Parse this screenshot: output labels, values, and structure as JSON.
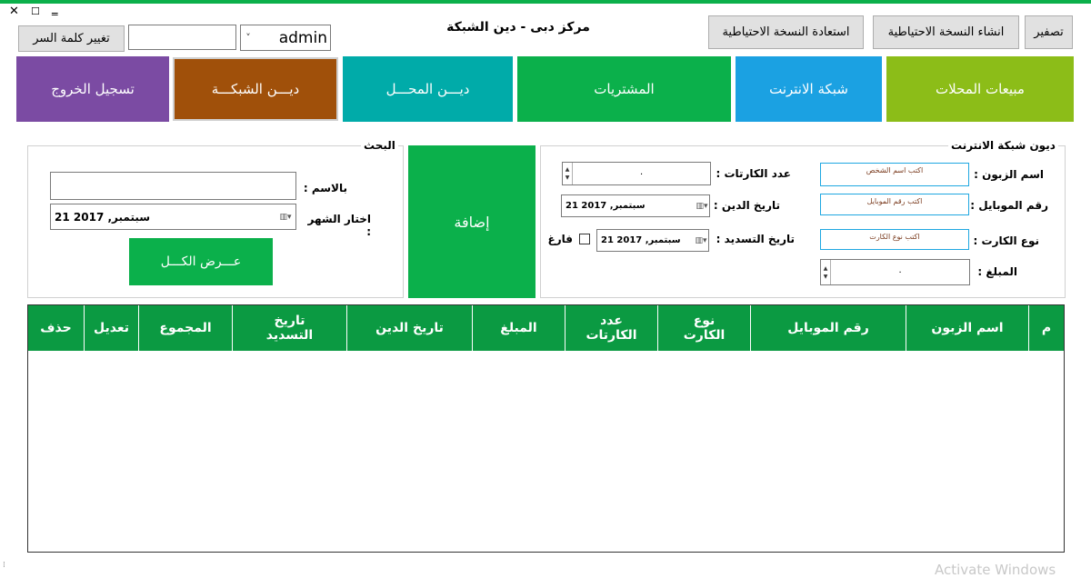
{
  "window": {
    "close_glyph": "✕",
    "maximize_glyph": "☐",
    "minimize_glyph": "‗"
  },
  "header": {
    "title": "مركز دبى - دين الشبكة",
    "change_password_label": "تغيير كلمة السر",
    "password_value": "",
    "user_selected": "admin",
    "user_dropdown_glyph": "˅",
    "clear_label": "تصفير",
    "create_backup_label": "انشاء النسخة الاحتياطية",
    "restore_backup_label": "استعادة النسخة الاحتياطية"
  },
  "nav": {
    "items": [
      {
        "label": "مبيعات المحلات",
        "color": "#8cbd18"
      },
      {
        "label": "شبكة الانترنت",
        "color": "#1ba1e2"
      },
      {
        "label": "المشتريات",
        "color": "#0bb04b"
      },
      {
        "label": "ديـــن المحـــل",
        "color": "#00aba9"
      },
      {
        "label": "ديـــن الشبكـــة",
        "color": "#a0500a"
      },
      {
        "label": "تسجيل الخروج",
        "color": "#7b4ba3"
      }
    ]
  },
  "debts_form": {
    "legend": "ديون شبكة الانترنت",
    "customer_name_label": "اسم الزبون :",
    "customer_name_placeholder": "اكتب اسم الشخص",
    "mobile_label": "رقم الموبايل :",
    "mobile_placeholder": "اكتب رقم الموبايل",
    "card_type_label": "نوع الكارت :",
    "card_type_placeholder": "اكتب نوع الكارت",
    "amount_label": "المبلغ :",
    "amount_value": "٠",
    "cards_count_label": "عدد الكارتات :",
    "cards_count_value": "٠",
    "debt_date_label": "تاريخ الدين :",
    "debt_date_value": "21 سبتمبر, 2017",
    "payment_date_label": "تاريخ التسديد :",
    "payment_date_value": "21 سبتمبر, 2017",
    "empty_label": "فارغ",
    "spin_up": "▲",
    "spin_down": "▼",
    "calendar_glyph": "▥▾"
  },
  "add_button_label": "إضافة",
  "search": {
    "legend": "البحث",
    "by_name_label": "بالاسم :",
    "by_name_value": "",
    "month_label": "اختار الشهر :",
    "month_value": "21 سبتمبر, 2017",
    "show_all_label": "عـــرض الكـــل"
  },
  "grid": {
    "columns": [
      "م",
      "اسم الزبون",
      "رقم الموبايل",
      "نوع الكارت",
      "عدد الكارتات",
      "المبلغ",
      "تاريخ الدين",
      "تاريخ التسديد",
      "المجموع",
      "تعديل",
      "حذف"
    ],
    "rows": []
  },
  "footer": {
    "watermark": "Activate Windows",
    "resize_glyph": "⁞"
  }
}
